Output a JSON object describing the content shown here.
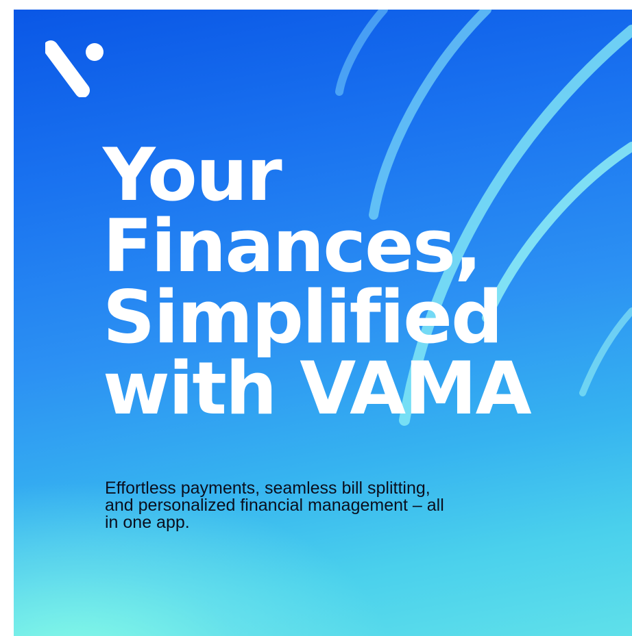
{
  "brand": {
    "logo_icon": "vama-logo-icon",
    "name": "VAMA"
  },
  "headline": {
    "line1": "Your",
    "line2": "Finances,",
    "line3": "Simplified",
    "line4": "with VAMA"
  },
  "subtitle": "Effortless payments, seamless bill splitting, and personalized financial management – all in one app.",
  "colors": {
    "background_top": "#0a57e6",
    "background_mid": "#2c91f3",
    "background_bottom_glow": "#8cffe6",
    "headline_text": "#ffffff",
    "subtitle_text": "#0a0f1e",
    "arc_stroke": "#7fe9f2"
  }
}
